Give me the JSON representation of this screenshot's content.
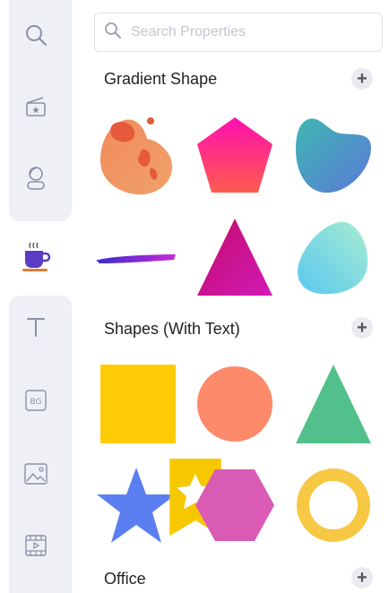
{
  "search": {
    "placeholder": "Search Properties"
  },
  "rail": {
    "items": [
      {
        "icon": "search-icon",
        "active": false
      },
      {
        "icon": "scene-icon",
        "active": false
      },
      {
        "icon": "character-icon",
        "active": false
      },
      {
        "icon": "coffee-cup-icon",
        "active": true
      },
      {
        "icon": "text-icon",
        "active": false
      },
      {
        "icon": "background-icon",
        "active": false,
        "label": "BG"
      },
      {
        "icon": "image-icon",
        "active": false
      },
      {
        "icon": "video-icon",
        "active": false
      }
    ]
  },
  "sections": [
    {
      "title": "Gradient Shape",
      "add_label": "+",
      "items": [
        "splash-blob",
        "pentagon",
        "wave-blob",
        "brush-stroke",
        "triangle",
        "rounded-blob"
      ]
    },
    {
      "title": "Shapes (With Text)",
      "add_label": "+",
      "items": [
        "square",
        "circle",
        "triangle",
        "star",
        "hexagon",
        "ring"
      ]
    },
    {
      "title": "Office",
      "add_label": "+",
      "items": []
    }
  ],
  "colors": {
    "rail_bg": "#eef0f6",
    "icon": "#8a90a6",
    "active_icon": "#5b3cc4",
    "square": "#ffcb05",
    "circle": "#fc8a6b",
    "triangle": "#52c08a",
    "star": "#5b7ff0",
    "hexagon": "#d95bb4",
    "ring": "#f7c844"
  }
}
